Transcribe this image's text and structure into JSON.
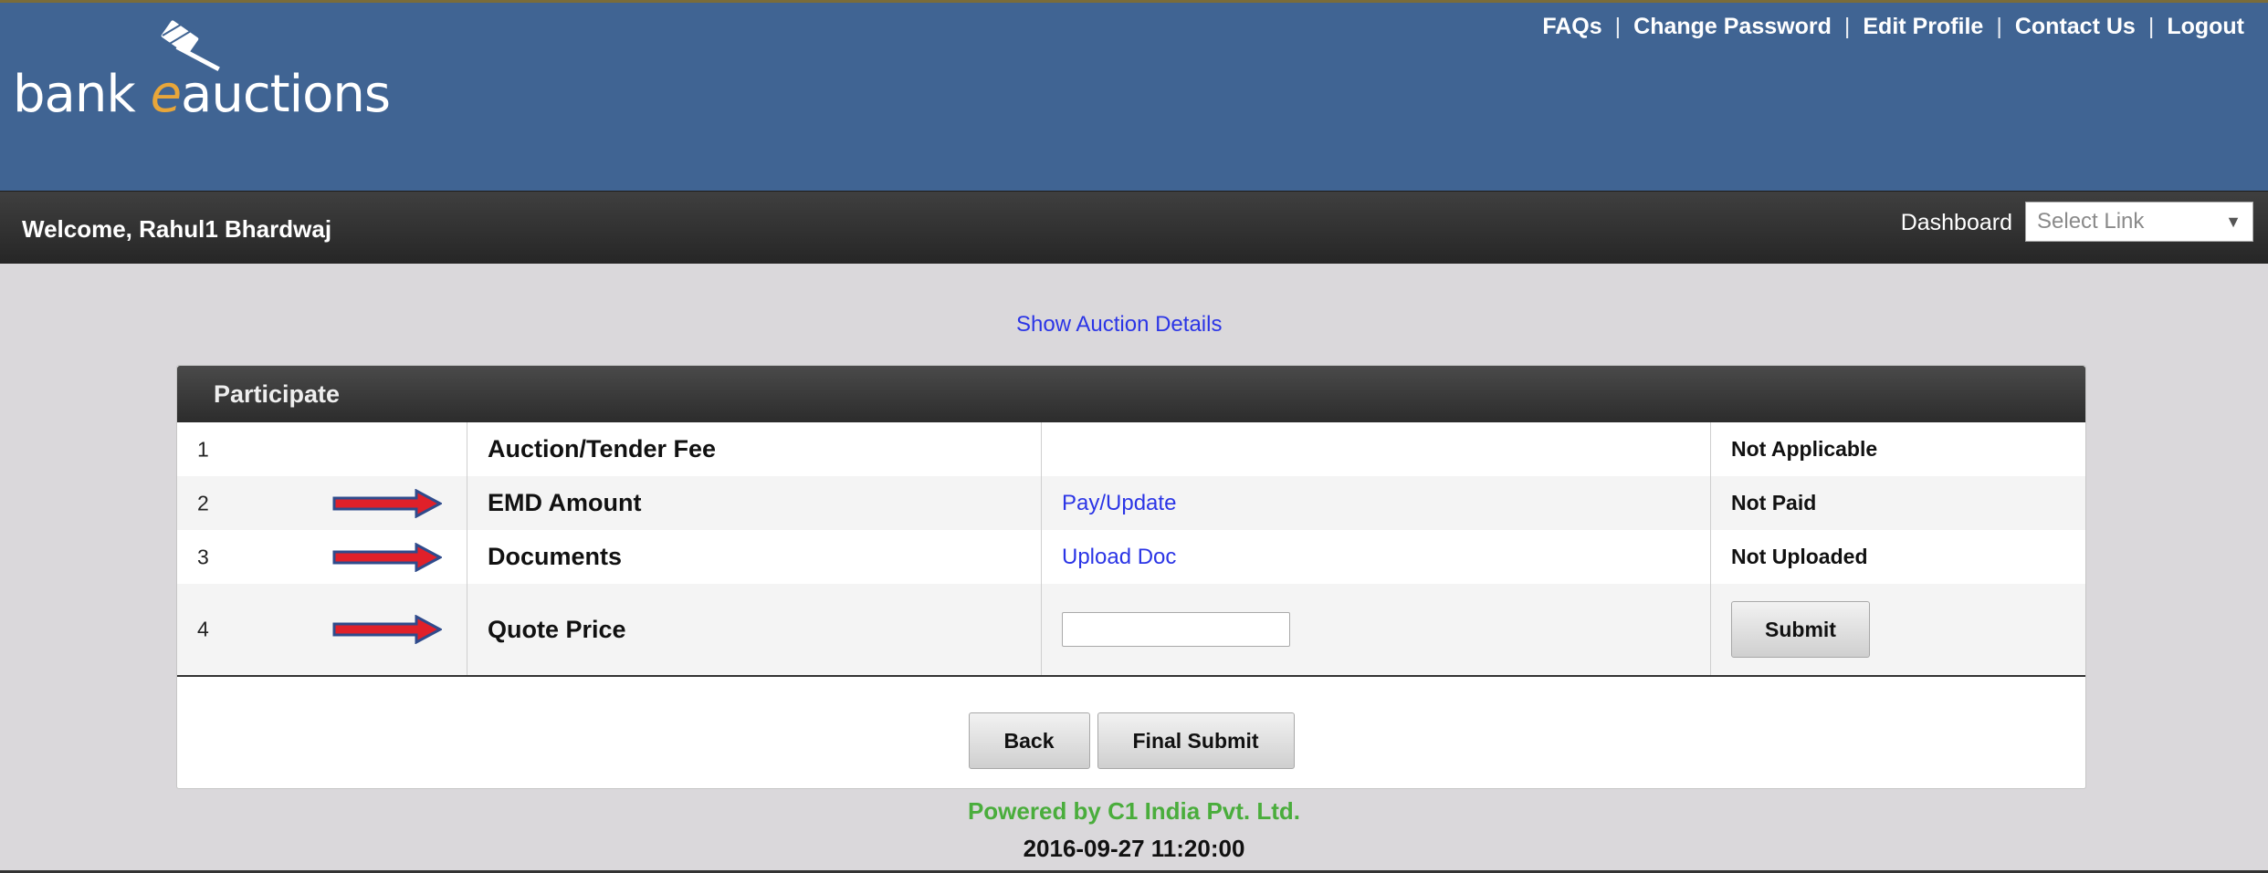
{
  "brand": {
    "logo_text_start": "bank ",
    "logo_text_accent": "e",
    "logo_text_end": "auctions",
    "logo_icon": "gavel-icon"
  },
  "top_nav": [
    "FAQs",
    "Change Password",
    "Edit Profile",
    "Contact Us",
    "Logout"
  ],
  "welcome_bar": {
    "welcome_text": "Welcome, Rahul1 Bhardwaj",
    "dashboard_label": "Dashboard",
    "dashboard_select_value": "Select Link"
  },
  "show_details_link": "Show Auction Details",
  "panel": {
    "title": "Participate",
    "rows": [
      {
        "num": "1",
        "item": "Auction/Tender Fee",
        "action": "",
        "status": "Not Applicable"
      },
      {
        "num": "2",
        "item": "EMD Amount",
        "action": "Pay/Update",
        "status": "Not Paid"
      },
      {
        "num": "3",
        "item": "Documents",
        "action": "Upload Doc",
        "status": "Not Uploaded"
      },
      {
        "num": "4",
        "item": "Quote Price",
        "action": "",
        "status": ""
      }
    ],
    "quote_input_value": "",
    "submit_label": "Submit",
    "back_label": "Back",
    "final_submit_label": "Final Submit"
  },
  "footer": {
    "powered_by": "Powered by C1 India Pvt. Ltd.",
    "timestamp": "2016-09-27 11:20:00"
  },
  "colors": {
    "header_bg": "#406493",
    "logo_accent": "#e8a63a",
    "link": "#2b35e6",
    "powered": "#4aad3c",
    "arrow_fill": "#e0202a",
    "arrow_outline": "#2f4b8c"
  }
}
